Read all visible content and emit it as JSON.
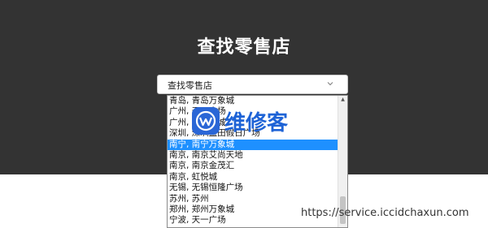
{
  "page": {
    "title": "查找零售店"
  },
  "select": {
    "value": "查找零售店",
    "chevron_icon": "chevron-down-icon"
  },
  "dropdown": {
    "options": [
      "青岛, 青岛万象城",
      "广州, 天环广场",
      "广州, 珠江新城",
      "深圳, 深圳益田假日广场",
      "南宁, 南宁万象城",
      "南京, 南京艾尚天地",
      "南京, 南京金茂汇",
      "南京, 虹悦城",
      "无锡, 无锡恒隆广场",
      "苏州, 苏州",
      "郑州, 郑州万象城",
      "宁波, 天一广场"
    ],
    "selected_index": 4
  },
  "watermark": {
    "text": "维修客",
    "logo_icon": "w-logo-icon"
  },
  "overlay": {
    "url": "https://service.iccidchaxun.com"
  },
  "colors": {
    "hero_bg": "#333333",
    "highlight": "#1e90ff",
    "brand_blue": "#1e63d6"
  }
}
